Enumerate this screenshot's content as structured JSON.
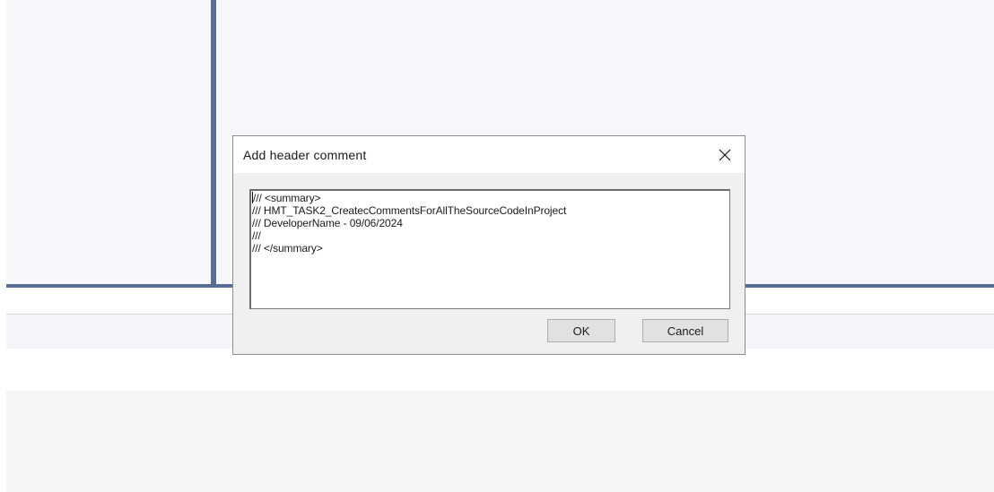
{
  "dialog": {
    "title": "Add header comment",
    "close_icon": "close-icon",
    "comment_lines": [
      "/// <summary>",
      "/// HMT_TASK2_CreatecCommentsForAllTheSourceCodeInProject",
      "/// DeveloperName - 09/06/2024",
      "///",
      "/// </summary>"
    ],
    "ok_label": "OK",
    "cancel_label": "Cancel"
  },
  "colors": {
    "splitter": "#576e98",
    "dialog_body": "#f0f0f0",
    "button_face": "#e1e1e1"
  }
}
